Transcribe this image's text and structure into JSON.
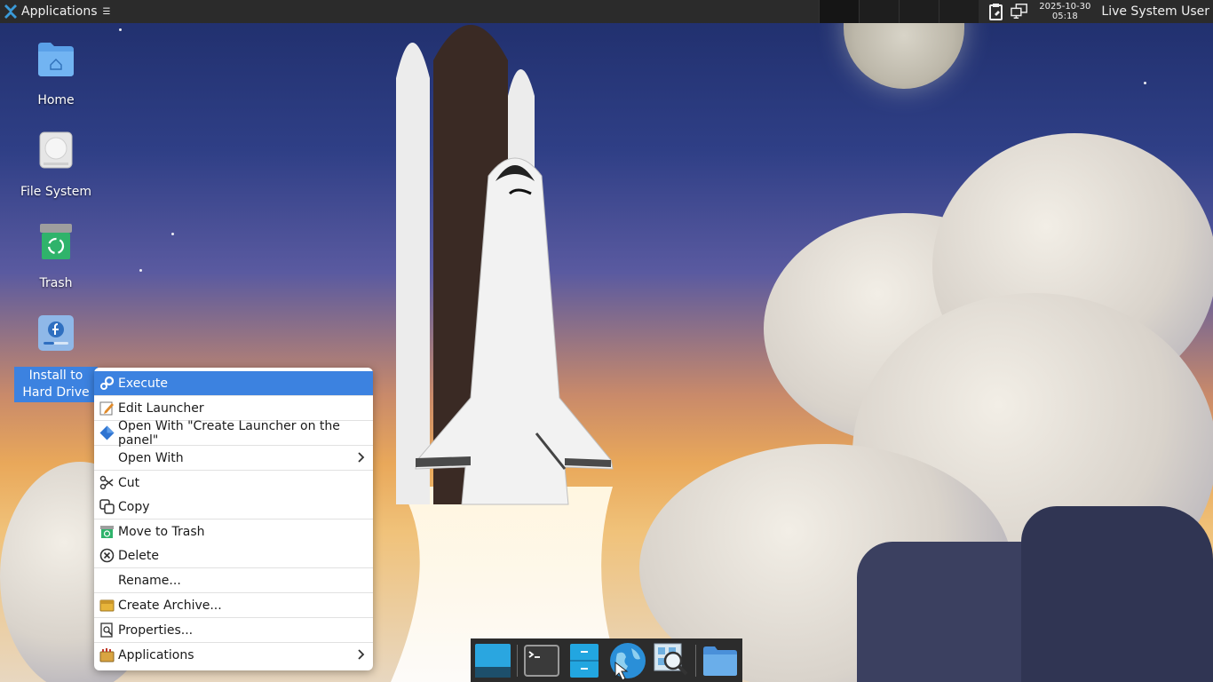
{
  "panel": {
    "applications_label": "Applications",
    "clock_date": "2025-10-30",
    "clock_time": "05:18",
    "user_label": "Live System User"
  },
  "desktop": {
    "icons": [
      {
        "label": "Home",
        "icon": "home-folder-icon"
      },
      {
        "label": "File System",
        "icon": "drive-icon"
      },
      {
        "label": "Trash",
        "icon": "trash-icon"
      },
      {
        "label": "Install to Hard Drive",
        "icon": "fedora-installer-icon"
      }
    ]
  },
  "context_menu": {
    "items": [
      {
        "label": "Execute",
        "icon": "gears-icon",
        "highlighted": true
      },
      {
        "label": "Edit Launcher",
        "icon": "edit-icon"
      },
      {
        "label": "Open With \"Create Launcher on the panel\"",
        "icon": "launcher-icon"
      },
      {
        "label": "Open With",
        "submenu": true
      },
      {
        "label": "Cut",
        "icon": "scissors-icon"
      },
      {
        "label": "Copy",
        "icon": "copy-icon"
      },
      {
        "label": "Move to Trash",
        "icon": "trash-icon"
      },
      {
        "label": "Delete",
        "icon": "delete-icon"
      },
      {
        "label": "Rename..."
      },
      {
        "label": "Create Archive...",
        "icon": "archive-icon"
      },
      {
        "label": "Properties...",
        "icon": "properties-icon"
      },
      {
        "label": "Applications",
        "icon": "applications-icon",
        "submenu": true
      }
    ]
  },
  "dock": {
    "items": [
      "show-desktop-icon",
      "terminal-icon",
      "file-manager-icon",
      "web-browser-icon",
      "app-finder-icon",
      "folder-icon"
    ]
  },
  "colors": {
    "panel_bg": "#2b2b2b",
    "highlight": "#3c82e0",
    "menu_bg": "#ffffff"
  }
}
